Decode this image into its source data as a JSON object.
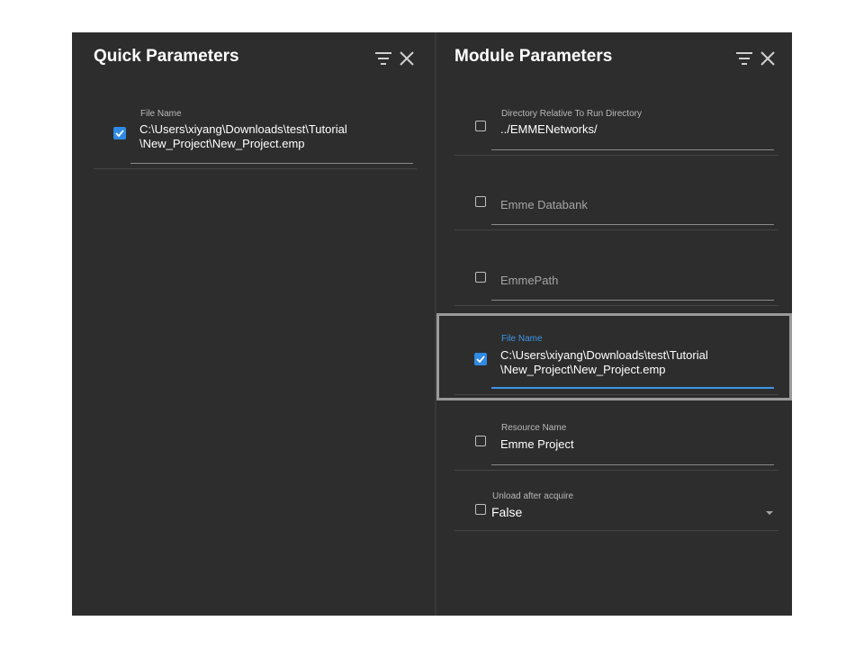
{
  "quick_panel": {
    "title": "Quick Parameters",
    "fields": [
      {
        "label": "File Name",
        "value_line1": "C:\\Users\\xiyang\\Downloads\\test\\Tutorial",
        "value_line2": "\\New_Project\\New_Project.emp",
        "checked": true
      }
    ],
    "icons": [
      "filter-icon",
      "close-icon"
    ]
  },
  "module_panel": {
    "title": "Module Parameters",
    "icons": [
      "filter-icon",
      "close-icon"
    ],
    "fields": [
      {
        "label": "Directory Relative To Run Directory",
        "value": "../EMMENetworks/",
        "checked": false
      },
      {
        "placeholder": "Emme Databank",
        "checked": false
      },
      {
        "placeholder": "EmmePath",
        "checked": false
      },
      {
        "label": "File Name",
        "value_line1": "C:\\Users\\xiyang\\Downloads\\test\\Tutorial",
        "value_line2": "\\New_Project\\New_Project.emp",
        "checked": true,
        "focused": true
      },
      {
        "label": "Resource Name",
        "value": "Emme Project",
        "checked": false
      },
      {
        "label": "Unload after acquire",
        "value": "False",
        "checked": false,
        "type": "select"
      }
    ]
  },
  "colors": {
    "panel_bg": "#2d2d2d",
    "accent": "#3d96e8",
    "checkbox_checked": "#2f8ae4"
  }
}
